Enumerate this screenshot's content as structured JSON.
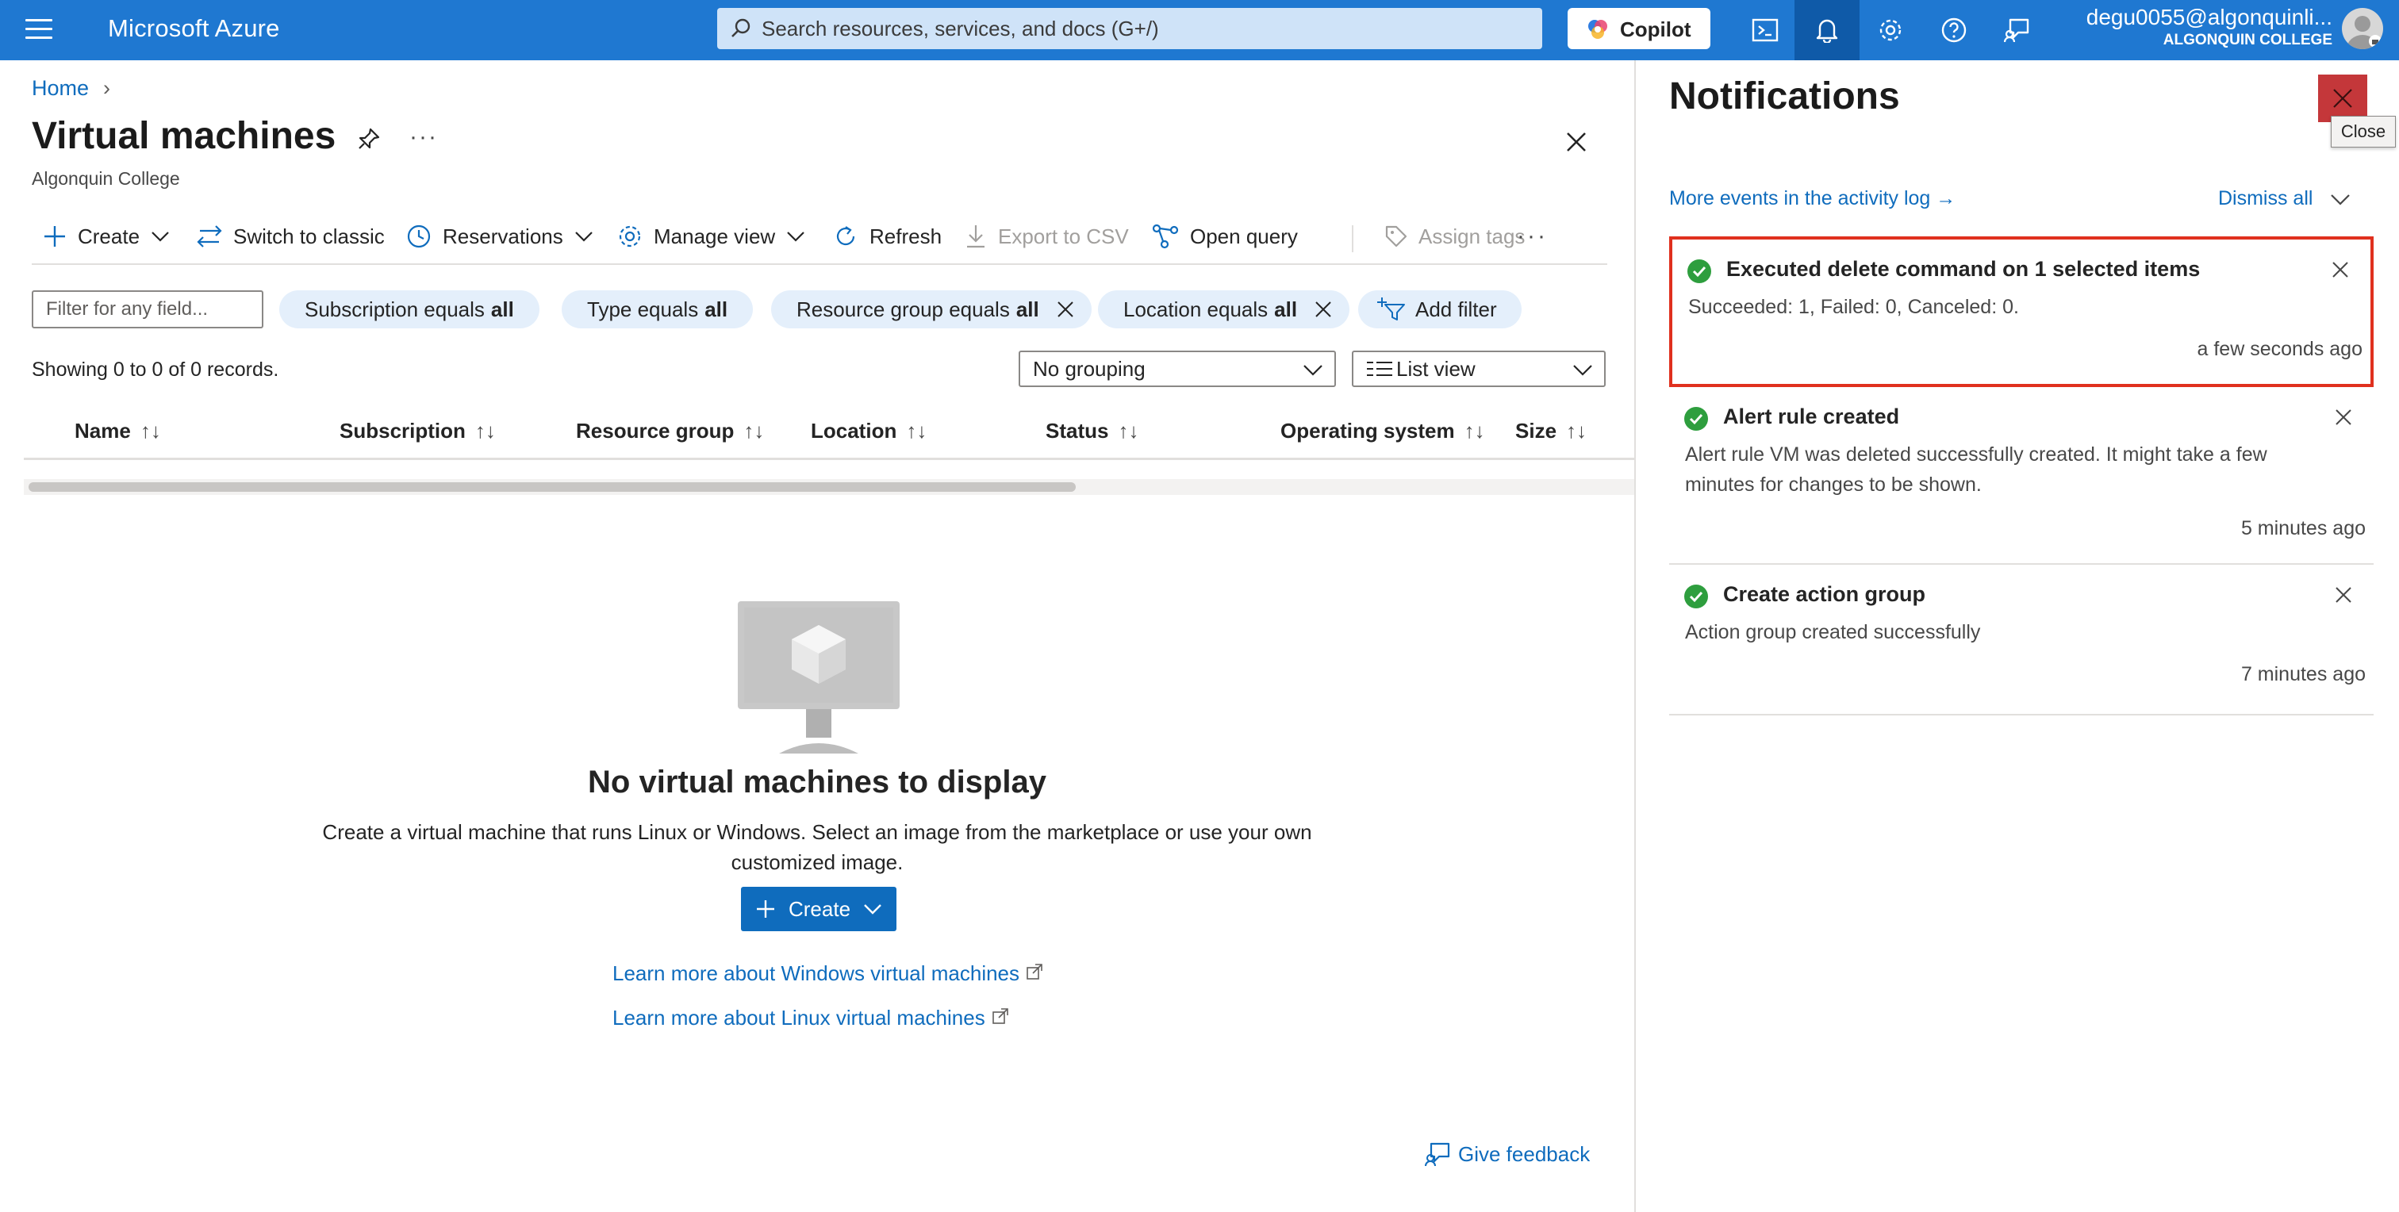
{
  "topbar": {
    "brand": "Microsoft Azure",
    "search_placeholder": "Search resources, services, and docs (G+/)",
    "copilot_label": "Copilot",
    "icons": [
      "cloud-shell-icon",
      "bell-icon",
      "gear-icon",
      "help-icon",
      "feedback-icon"
    ],
    "account_email": "degu0055@algonquinli...",
    "account_org": "ALGONQUIN COLLEGE",
    "accent_color": "#1f78d1"
  },
  "breadcrumb": {
    "home": "Home"
  },
  "page": {
    "title": "Virtual machines",
    "subtitle": "Algonquin College"
  },
  "toolbar": {
    "create": "Create",
    "switch_classic": "Switch to classic",
    "reservations": "Reservations",
    "manage_view": "Manage view",
    "refresh": "Refresh",
    "export_csv": "Export to CSV",
    "open_query": "Open query",
    "assign_tags": "Assign tags"
  },
  "filters": {
    "placeholder": "Filter for any field...",
    "pills": [
      {
        "label": "Subscription equals",
        "value": "all"
      },
      {
        "label": "Type equals",
        "value": "all"
      },
      {
        "label": "Resource group equals",
        "value": "all"
      },
      {
        "label": "Location equals",
        "value": "all"
      }
    ],
    "add_filter": "Add filter"
  },
  "list": {
    "showing": "Showing 0 to 0 of 0 records.",
    "grouping": "No grouping",
    "view": "List view",
    "columns": [
      "Name",
      "Subscription",
      "Resource group",
      "Location",
      "Status",
      "Operating system",
      "Size"
    ]
  },
  "empty": {
    "title": "No virtual machines to display",
    "description": "Create a virtual machine that runs Linux or Windows. Select an image from the marketplace or use your own customized image.",
    "create_button": "Create",
    "learn_windows": "Learn more about Windows virtual machines",
    "learn_linux": "Learn more about Linux virtual machines",
    "feedback": "Give feedback"
  },
  "notifications": {
    "title": "Notifications",
    "close_tooltip": "Close",
    "more_events": "More events in the activity log →",
    "dismiss_all": "Dismiss all",
    "items": [
      {
        "title": "Executed delete command on 1 selected items",
        "body": "Succeeded: 1, Failed: 0, Canceled: 0.",
        "time": "a few seconds ago",
        "status": "success"
      },
      {
        "title": "Alert rule created",
        "body": "Alert rule VM was deleted successfully created. It might take a few minutes for changes to be shown.",
        "time": "5 minutes ago",
        "status": "success"
      },
      {
        "title": "Create action group",
        "body": "Action group created successfully",
        "time": "7 minutes ago",
        "status": "success"
      }
    ],
    "highlight_color": "#e0301e",
    "success_color": "#2e9e3e"
  }
}
